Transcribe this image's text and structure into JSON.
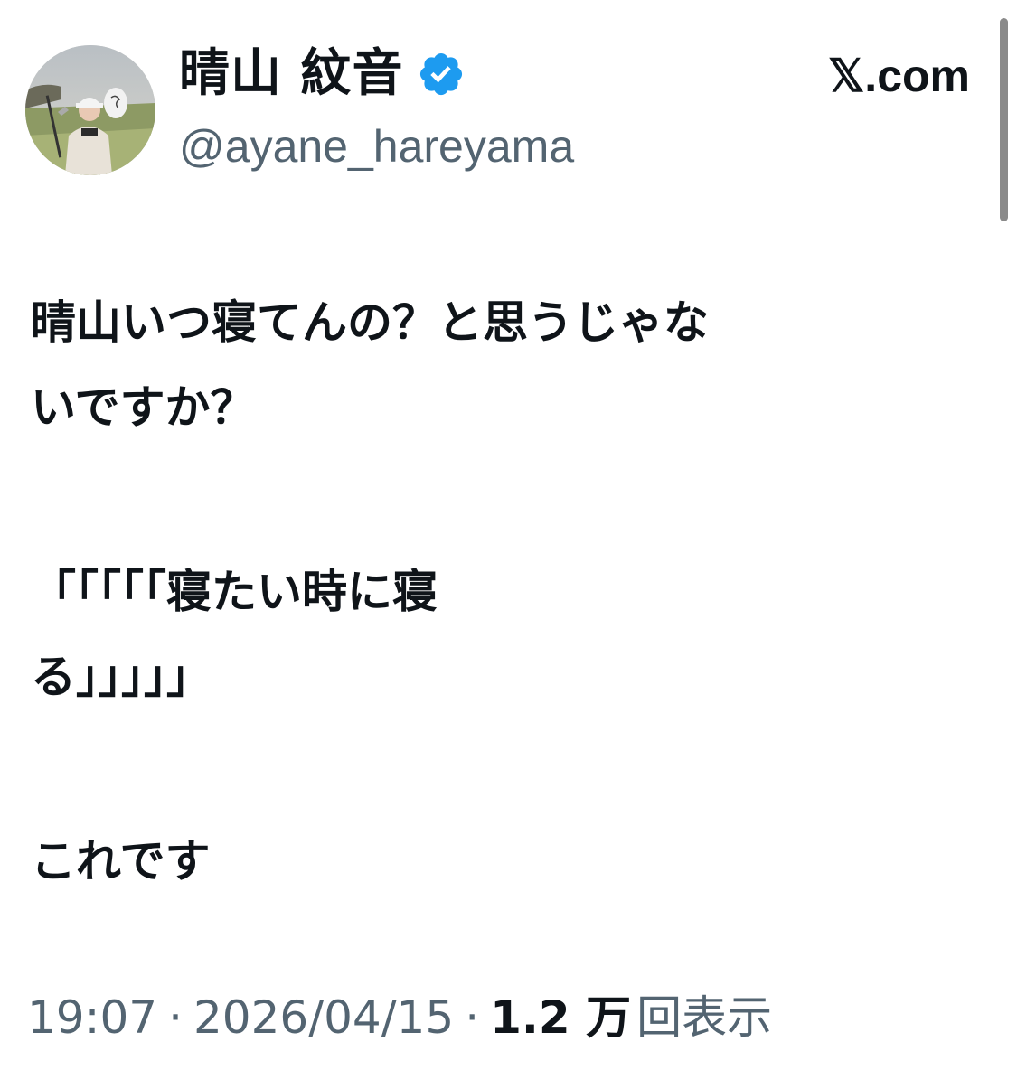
{
  "author": {
    "display_name": "晴山 紋音",
    "handle": "@ayane_hareyama",
    "verified": true,
    "verified_color": "#1d9bf0"
  },
  "source_site": "𝕏.com",
  "tweet": {
    "lines": [
      "晴山いつ寝てんの？と思うじゃな",
      "いですか？",
      "「「「「「寝たい時に寝",
      "る」」」」」",
      "これです"
    ]
  },
  "meta": {
    "time": "19:07",
    "separator": "·",
    "date": "2026/04/15",
    "views_count": "1.2 万",
    "views_label": "回表示"
  },
  "colors": {
    "text_primary": "#0f1419",
    "text_secondary": "#536471"
  }
}
